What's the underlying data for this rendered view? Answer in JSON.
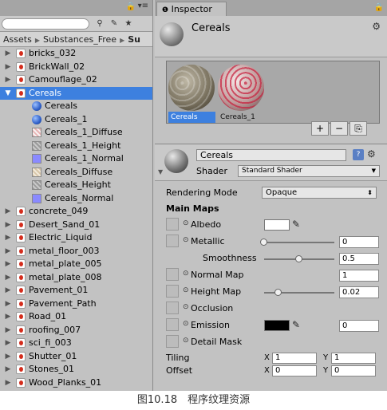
{
  "project": {
    "breadcrumb": [
      "Assets",
      "Substances_Free",
      "Su"
    ],
    "items": [
      {
        "label": "bricks_032",
        "type": "sbs",
        "level": 0,
        "expand": "collapsed"
      },
      {
        "label": "BrickWall_02",
        "type": "sbs",
        "level": 0,
        "expand": "collapsed"
      },
      {
        "label": "Camouflage_02",
        "type": "sbs",
        "level": 0,
        "expand": "collapsed"
      },
      {
        "label": "Cereals",
        "type": "sbs",
        "level": 0,
        "expand": "expanded",
        "selected": true
      },
      {
        "label": "Cereals",
        "type": "mat",
        "level": 1
      },
      {
        "label": "Cereals_1",
        "type": "mat",
        "level": 1
      },
      {
        "label": "Cereals_1_Diffuse",
        "type": "tex-cereal",
        "level": 1
      },
      {
        "label": "Cereals_1_Height",
        "type": "tex-gray",
        "level": 1
      },
      {
        "label": "Cereals_1_Normal",
        "type": "tex-blue",
        "level": 1
      },
      {
        "label": "Cereals_Diffuse",
        "type": "tex-beige",
        "level": 1
      },
      {
        "label": "Cereals_Height",
        "type": "tex-gray",
        "level": 1
      },
      {
        "label": "Cereals_Normal",
        "type": "tex-blue",
        "level": 1
      },
      {
        "label": "concrete_049",
        "type": "sbs",
        "level": 0,
        "expand": "collapsed"
      },
      {
        "label": "Desert_Sand_01",
        "type": "sbs",
        "level": 0,
        "expand": "collapsed"
      },
      {
        "label": "Electric_Liquid",
        "type": "sbs",
        "level": 0,
        "expand": "collapsed"
      },
      {
        "label": "metal_floor_003",
        "type": "sbs",
        "level": 0,
        "expand": "collapsed"
      },
      {
        "label": "metal_plate_005",
        "type": "sbs",
        "level": 0,
        "expand": "collapsed"
      },
      {
        "label": "metal_plate_008",
        "type": "sbs",
        "level": 0,
        "expand": "collapsed"
      },
      {
        "label": "Pavement_01",
        "type": "sbs",
        "level": 0,
        "expand": "collapsed"
      },
      {
        "label": "Pavement_Path",
        "type": "sbs",
        "level": 0,
        "expand": "collapsed"
      },
      {
        "label": "Road_01",
        "type": "sbs",
        "level": 0,
        "expand": "collapsed"
      },
      {
        "label": "roofing_007",
        "type": "sbs",
        "level": 0,
        "expand": "collapsed"
      },
      {
        "label": "sci_fi_003",
        "type": "sbs",
        "level": 0,
        "expand": "collapsed"
      },
      {
        "label": "Shutter_01",
        "type": "sbs",
        "level": 0,
        "expand": "collapsed"
      },
      {
        "label": "Stones_01",
        "type": "sbs",
        "level": 0,
        "expand": "collapsed"
      },
      {
        "label": "Wood_Planks_01",
        "type": "sbs",
        "level": 0,
        "expand": "collapsed"
      }
    ]
  },
  "inspector": {
    "tab_label": "Inspector",
    "asset_title": "Cereals",
    "previews": [
      {
        "label": "Cereals",
        "selected": true
      },
      {
        "label": "Cereals_1",
        "selected": false
      }
    ],
    "preview_buttons": [
      "+",
      "−",
      "⎘"
    ],
    "material": {
      "name": "Cereals",
      "shader_label": "Shader",
      "shader_value": "Standard Shader"
    },
    "rendering_mode_label": "Rendering Mode",
    "rendering_mode_value": "Opaque",
    "main_maps_label": "Main Maps",
    "albedo_label": "Albedo",
    "metallic_label": "Metallic",
    "metallic_value": "0",
    "metallic_slider": 0,
    "smoothness_label": "Smoothness",
    "smoothness_value": "0.5",
    "smoothness_slider": 0.5,
    "normal_label": "Normal Map",
    "normal_value": "1",
    "height_label": "Height Map",
    "height_value": "0.02",
    "height_slider": 0.2,
    "occlusion_label": "Occlusion",
    "emission_label": "Emission",
    "emission_value": "0",
    "detail_mask_label": "Detail Mask",
    "tiling_label": "Tiling",
    "offset_label": "Offset",
    "x_label": "X",
    "y_label": "Y",
    "tiling_x": "1",
    "tiling_y": "1",
    "offset_x": "0",
    "offset_y": "0",
    "colors": {
      "albedo": "#ffffff",
      "emission": "#000000",
      "selection": "#3d80df"
    }
  },
  "caption": "图10.18　程序纹理资源"
}
